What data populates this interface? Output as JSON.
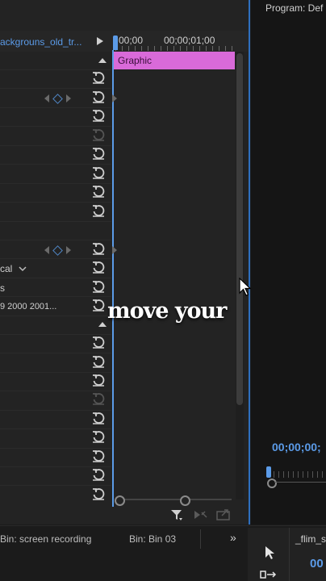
{
  "effect_controls": {
    "clip_name": "ackgrouns_old_tr...",
    "timecode_start": "00;00",
    "timecode_end": "00;00;01;00",
    "graphic_clip_label": "Graphic",
    "dropdown_value": "cal",
    "row_text_s": "s",
    "font_list_value": "9 2000 2001..."
  },
  "program_monitor": {
    "title": "Program: Def",
    "timecode": "00;00;00;"
  },
  "bins": {
    "bin_screen_recording": "Bin: screen recording",
    "bin_03": "Bin: Bin 03",
    "more_label": "»",
    "flim_tab": "_flim_s",
    "flim_timecode": "00"
  },
  "caption": {
    "text": "move your"
  },
  "colors": {
    "accent_blue": "#5b9be8",
    "graphic_clip": "#d96ad9",
    "panel_bg": "#232323"
  }
}
